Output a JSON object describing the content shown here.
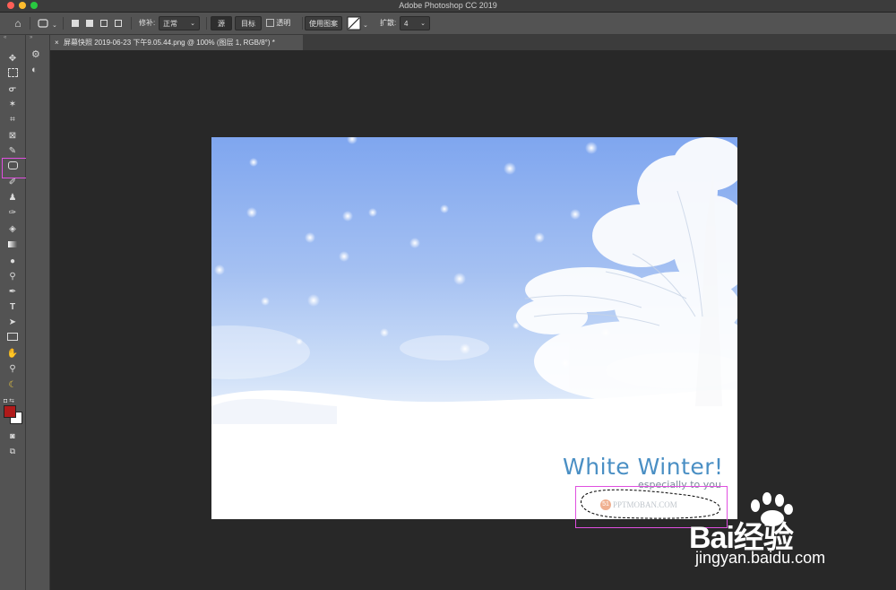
{
  "window": {
    "title": "Adobe Photoshop CC 2019"
  },
  "options_bar": {
    "patch_label": "修补:",
    "patch_mode": "正常",
    "source_btn": "源",
    "target_btn": "目标",
    "transparent_label": "透明",
    "use_pattern_btn": "使用图案",
    "diffusion_label": "扩散:",
    "diffusion_value": "4"
  },
  "document_tab": {
    "title": "屏幕快照 2019-06-23 下午9.05.44.png @ 100% (图层 1, RGB/8°) *"
  },
  "image": {
    "headline": "White Winter!",
    "subline": "especially to you",
    "logo_text": "PPTMOBAN.COM",
    "logo_num": "51"
  },
  "watermark": {
    "brand": "Bai经验",
    "url": "jingyan.baidu.com"
  },
  "colors": {
    "highlight": "#e04fe0",
    "foreground": "#b01a1a",
    "background": "#ffffff",
    "headline": "#4a8fc4"
  },
  "tools": [
    "move-icon",
    "marquee-icon",
    "lasso-icon",
    "magic-wand-icon",
    "crop-icon",
    "frame-icon",
    "eyedropper-icon",
    "patch-icon",
    "brush-icon",
    "stamp-icon",
    "history-brush-icon",
    "eraser-icon",
    "gradient-icon",
    "blur-icon",
    "dodge-icon",
    "pen-icon",
    "type-icon",
    "path-select-icon",
    "rectangle-icon",
    "hand-icon",
    "zoom-icon",
    "banana-icon"
  ]
}
